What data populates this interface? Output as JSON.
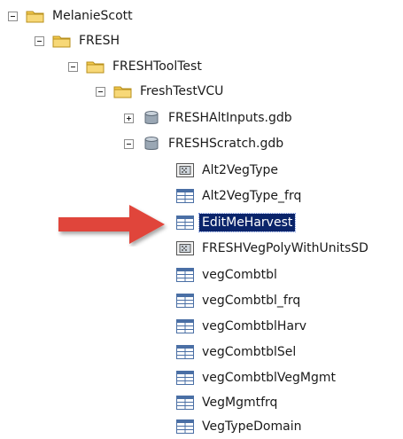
{
  "tree": {
    "nodes": [
      {
        "label": "MelanieScott",
        "type": "folder",
        "expander": "minus"
      },
      {
        "label": "FRESH",
        "type": "folder",
        "expander": "minus"
      },
      {
        "label": "FRESHToolTest",
        "type": "folder",
        "expander": "minus"
      },
      {
        "label": "FreshTestVCU",
        "type": "folder",
        "expander": "minus"
      },
      {
        "label": "FRESHAltInputs.gdb",
        "type": "geodatabase",
        "expander": "plus"
      },
      {
        "label": "FRESHScratch.gdb",
        "type": "geodatabase",
        "expander": "minus"
      },
      {
        "label": "Alt2VegType",
        "type": "raster"
      },
      {
        "label": "Alt2VegType_frq",
        "type": "table"
      },
      {
        "label": "EditMeHarvest",
        "type": "table",
        "selected": true
      },
      {
        "label": "FRESHVegPolyWithUnitsSD",
        "type": "raster"
      },
      {
        "label": "vegCombtbl",
        "type": "table"
      },
      {
        "label": "vegCombtbl_frq",
        "type": "table"
      },
      {
        "label": "vegCombtblHarv",
        "type": "table"
      },
      {
        "label": "vegCombtblSel",
        "type": "table"
      },
      {
        "label": "vegCombtblVegMgmt",
        "type": "table"
      },
      {
        "label": "VegMgmtfrq",
        "type": "table"
      },
      {
        "label": "VegTypeDomain",
        "type": "table"
      }
    ]
  },
  "annotation": {
    "icon": "red-arrow-icon",
    "color": "#e0453a"
  },
  "colors": {
    "selection": "#0a246a",
    "folder": "#f2c94c",
    "database": "#9aa7b4",
    "table": "#4a6fa5"
  }
}
